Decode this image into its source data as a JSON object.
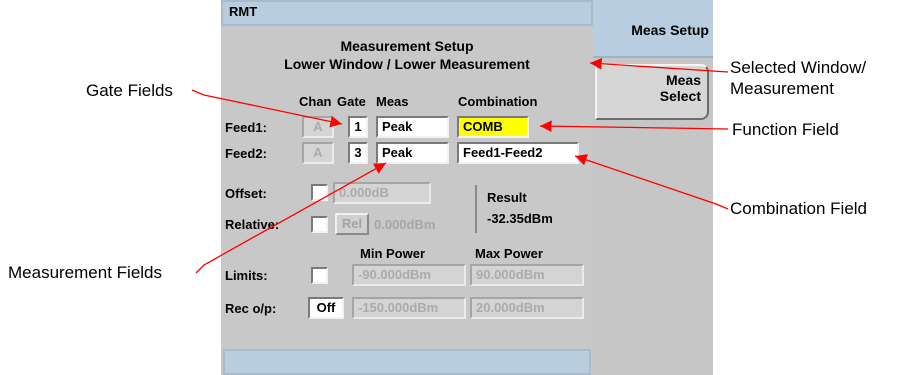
{
  "window": {
    "status": "RMT"
  },
  "title": {
    "line1": "Measurement Setup",
    "line2": "Lower Window / Lower Measurement"
  },
  "headers": {
    "chan": "Chan",
    "gate": "Gate",
    "meas": "Meas",
    "combination": "Combination"
  },
  "feeds": [
    {
      "label": "Feed1:",
      "chan": "A",
      "gate": "1",
      "meas": "Peak",
      "combination": "COMB"
    },
    {
      "label": "Feed2:",
      "chan": "A",
      "gate": "3",
      "meas": "Peak",
      "combination": "Feed1-Feed2"
    }
  ],
  "offset": {
    "label": "Offset:",
    "value": "0.000dB"
  },
  "relative": {
    "label": "Relative:",
    "button": "Rel",
    "value": "0.000dBm"
  },
  "result": {
    "label": "Result",
    "value": "-32.35dBm"
  },
  "limits": {
    "label": "Limits:",
    "min_header": "Min Power",
    "max_header": "Max Power",
    "min": "-90.000dBm",
    "max": "90.000dBm"
  },
  "rec_op": {
    "label": "Rec o/p:",
    "state": "Off",
    "min": "-150.000dBm",
    "max": "20.000dBm"
  },
  "softkeys": {
    "header": "Meas Setup",
    "meas_select_line1": "Meas",
    "meas_select_line2": "Select"
  },
  "annotations": {
    "gate_fields": "Gate Fields",
    "selected_window_1": "Selected Window/",
    "selected_window_2": "Measurement",
    "function_field": "Function Field",
    "combination_field": "Combination Field",
    "measurement_fields": "Measurement Fields"
  },
  "colors": {
    "screen_bg": "#c8c8c8",
    "status_bar": "#b9cde0",
    "highlight": "#ffff00",
    "arrow": "#ff0000"
  }
}
